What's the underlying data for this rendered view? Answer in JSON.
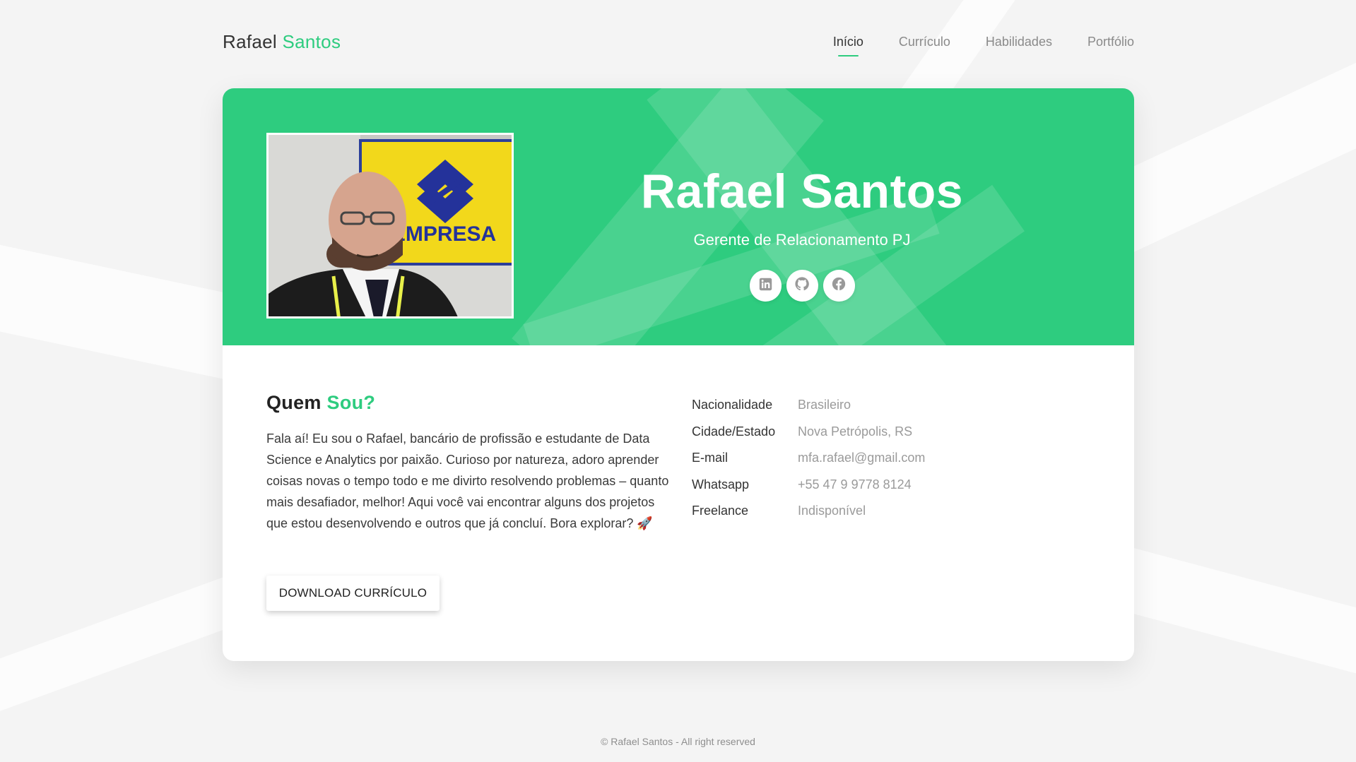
{
  "brand": {
    "first": "Rafael",
    "last": "Santos"
  },
  "nav": {
    "items": [
      {
        "label": "Início",
        "active": true
      },
      {
        "label": "Currículo",
        "active": false
      },
      {
        "label": "Habilidades",
        "active": false
      },
      {
        "label": "Portfólio",
        "active": false
      }
    ]
  },
  "hero": {
    "name": "Rafael Santos",
    "role": "Gerente de Relacionamento PJ",
    "photo_sign_text": "EMPRESA",
    "social": [
      {
        "icon": "linkedin-icon"
      },
      {
        "icon": "github-icon"
      },
      {
        "icon": "facebook-icon"
      }
    ]
  },
  "about": {
    "heading_first": "Quem",
    "heading_accent": "Sou?",
    "text": "Fala aí! Eu sou o Rafael, bancário de profissão e estudante de Data Science e Analytics por paixão. Curioso por natureza, adoro aprender coisas novas o tempo todo e me divirto resolvendo problemas – quanto mais desafiador, melhor! Aqui você vai encontrar alguns dos projetos que estou desenvolvendo e outros que já concluí. Bora explorar? 🚀",
    "download_label": "DOWNLOAD CURRÍCULO"
  },
  "info": [
    {
      "key": "Nacionalidade",
      "value": "Brasileiro"
    },
    {
      "key": "Cidade/Estado",
      "value": "Nova Petrópolis, RS"
    },
    {
      "key": "E-mail",
      "value": "mfa.rafael@gmail.com"
    },
    {
      "key": "Whatsapp",
      "value": "+55 47 9 9778 8124"
    },
    {
      "key": "Freelance",
      "value": "Indisponível"
    }
  ],
  "footer": {
    "text": "© Rafael Santos - All right reserved"
  },
  "colors": {
    "accent": "#2ecc7f",
    "background": "#f4f4f4",
    "card": "#ffffff"
  }
}
